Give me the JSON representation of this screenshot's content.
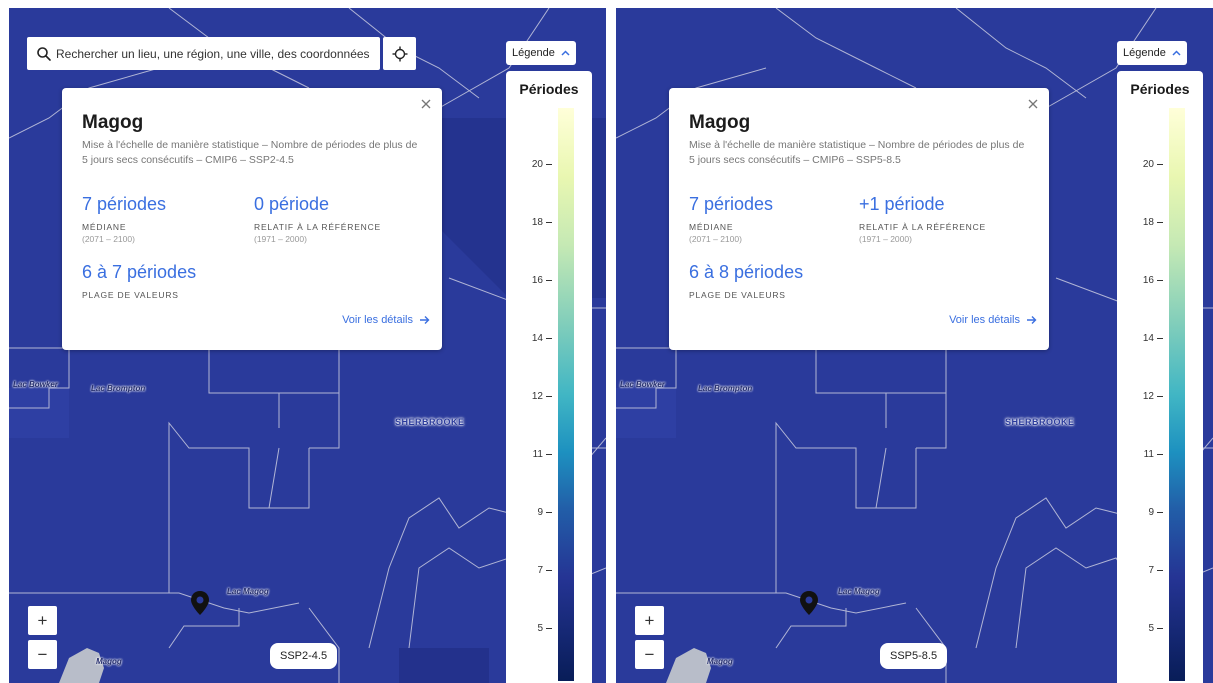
{
  "search": {
    "placeholder": "Rechercher un lieu, une région, une ville, des coordonnées"
  },
  "map_labels": {
    "lac_bowker": "Lac Bowker",
    "lac_brompton": "Lac Brompton",
    "sherbrooke": "SHERBROOKE",
    "lac_magog": "Lac Magog",
    "magog": "Magog"
  },
  "legend": {
    "toggle_label": "Légende",
    "title": "Périodes",
    "ticks": [
      "20",
      "18",
      "16",
      "14",
      "12",
      "11",
      "9",
      "7",
      "5"
    ],
    "colors": [
      "#ffffd9",
      "#c7e9b4",
      "#41b6c4",
      "#225ea8",
      "#081d58"
    ]
  },
  "colors": {
    "map_fill": "#2a3a9b",
    "accent": "#3a6fe0"
  },
  "panels": {
    "left": {
      "city": "Magog",
      "description": "Mise à l'échelle de manière statistique – Nombre de périodes de plus de 5 jours secs consécutifs – CMIP6 – SSP2-4.5",
      "median_value": "7 périodes",
      "median_label": "MÉDIANE",
      "median_years": "(2071 – 2100)",
      "relative_value": "0 période",
      "relative_label": "RELATIF À LA RÉFÉRENCE",
      "relative_years": "(1971 – 2000)",
      "range_value": "6 à 7 périodes",
      "range_label": "PLAGE DE VALEURS",
      "details_link": "Voir les détails",
      "scenario": "SSP2-4.5"
    },
    "right": {
      "city": "Magog",
      "description": "Mise à l'échelle de manière statistique – Nombre de périodes de plus de 5 jours secs consécutifs – CMIP6 – SSP5-8.5",
      "median_value": "7 périodes",
      "median_label": "MÉDIANE",
      "median_years": "(2071 – 2100)",
      "relative_value": "+1 période",
      "relative_label": "RELATIF À LA RÉFÉRENCE",
      "relative_years": "(1971 – 2000)",
      "range_value": "6 à 8 périodes",
      "range_label": "PLAGE DE VALEURS",
      "details_link": "Voir les détails",
      "scenario": "SSP5-8.5"
    }
  },
  "zoom": {
    "in_label": "+",
    "out_label": "−"
  }
}
